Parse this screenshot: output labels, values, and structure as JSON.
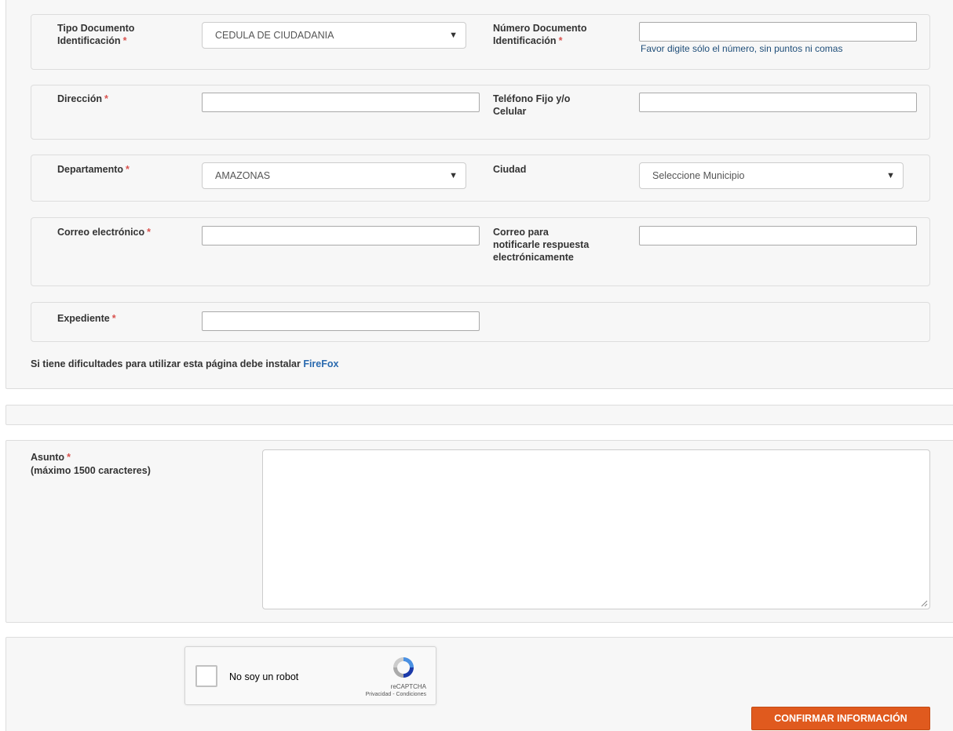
{
  "form": {
    "tipo_documento": {
      "label": "Tipo Documento\nIdentificación",
      "required_mark": "*",
      "selected": "CEDULA DE CIUDADANIA"
    },
    "numero_documento": {
      "label": "Número Documento\nIdentificación",
      "required_mark": "*",
      "value": "",
      "hint": "Favor digite sólo el número, sin puntos ni comas"
    },
    "direccion": {
      "label": "Dirección",
      "required_mark": "*",
      "value": ""
    },
    "telefono": {
      "label": "Teléfono Fijo y/o\nCelular",
      "value": ""
    },
    "departamento": {
      "label": "Departamento",
      "required_mark": "*",
      "selected": "AMAZONAS"
    },
    "ciudad": {
      "label": "Ciudad",
      "selected": "Seleccione Municipio"
    },
    "correo": {
      "label": "Correo electrónico",
      "required_mark": "*",
      "value": ""
    },
    "correo_notificar": {
      "label": "Correo para\nnotificarle respuesta\nelectrónicamente",
      "value": ""
    },
    "expediente": {
      "label": "Expediente",
      "required_mark": "*",
      "value": ""
    },
    "firefox_note": {
      "text": "Si tiene dificultades para utilizar esta página debe instalar ",
      "link": "FireFox"
    },
    "asunto": {
      "label": "Asunto",
      "required_mark": "*",
      "sublabel": "(máximo 1500 caracteres)",
      "value": ""
    }
  },
  "captcha": {
    "label": "No soy un robot",
    "brand": "reCAPTCHA",
    "links": "Privacidad - Condiciones",
    "checked": false
  },
  "submit": {
    "label": "CONFIRMAR INFORMACIÓN"
  },
  "icons": {
    "select_arrow": "triangle-down-icon",
    "captcha_logo": "recaptcha-icon",
    "resize": "resize-handle-icon"
  },
  "colors": {
    "required": "#d9534f",
    "link": "#2a6aaf",
    "hint": "#1f4e79",
    "button": "#e05a1e",
    "panel_bg": "#f7f7f7"
  }
}
